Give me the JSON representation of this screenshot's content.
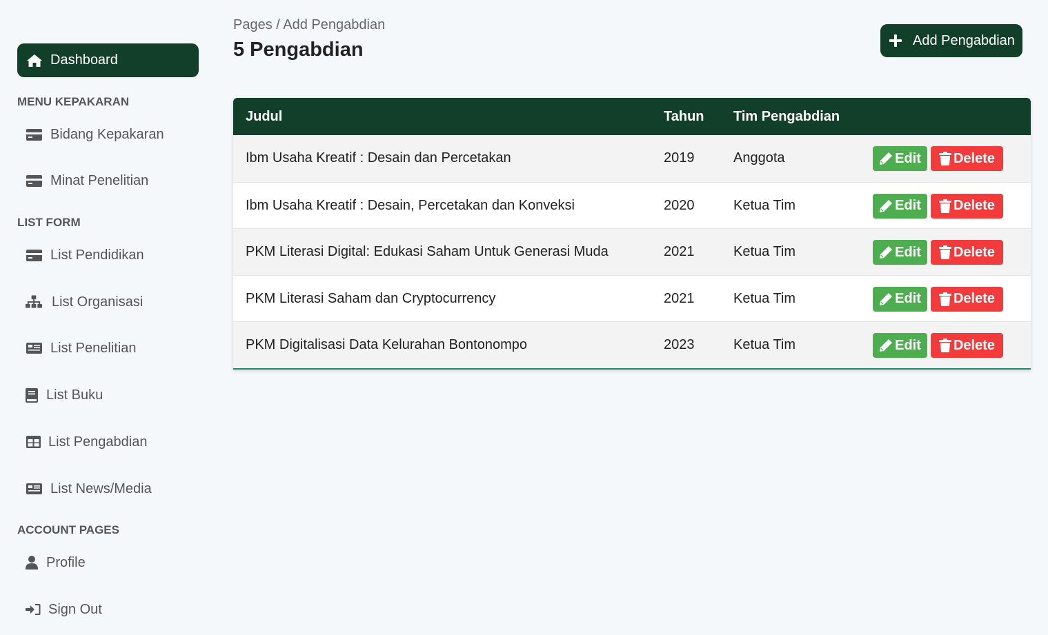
{
  "sidebar": {
    "dashboard_label": "Dashboard",
    "sections": {
      "menu_kepakaran": "MENU KEPAKARAN",
      "list_form": "LIST FORM",
      "account_pages": "ACCOUNT PAGES"
    },
    "items": {
      "bidang_kepakaran": "Bidang Kepakaran",
      "minat_penelitian": "Minat Penelitian",
      "list_pendidikan": "List Pendidikan",
      "list_organisasi": "List Organisasi",
      "list_penelitian": "List Penelitian",
      "list_buku": "List Buku",
      "list_pengabdian": "List Pengabdian",
      "list_news_media": "List News/Media",
      "profile": "Profile",
      "sign_out": "Sign Out"
    }
  },
  "header": {
    "breadcrumb": "Pages / Add Pengabdian",
    "title": "5 Pengabdian",
    "add_button_label": "Add Pengabdian"
  },
  "table": {
    "columns": [
      "Judul",
      "Tahun",
      "Tim Pengabdian"
    ],
    "edit_label": "Edit",
    "delete_label": "Delete",
    "rows": [
      {
        "judul": "Ibm Usaha Kreatif : Desain dan Percetakan",
        "tahun": "2019",
        "tim": "Anggota"
      },
      {
        "judul": "Ibm Usaha Kreatif : Desain, Percetakan dan Konveksi",
        "tahun": "2020",
        "tim": "Ketua Tim"
      },
      {
        "judul": "PKM Literasi Digital: Edukasi Saham Untuk Generasi Muda",
        "tahun": "2021",
        "tim": "Ketua Tim"
      },
      {
        "judul": "PKM Literasi Saham dan Cryptocurrency",
        "tahun": "2021",
        "tim": "Ketua Tim"
      },
      {
        "judul": "PKM Digitalisasi Data Kelurahan Bontonompo",
        "tahun": "2023",
        "tim": "Ketua Tim"
      }
    ]
  },
  "colors": {
    "primary_dark_green": "#123f2a",
    "edit_green": "#4cae4f",
    "delete_red": "#f43b3b",
    "background": "#f5f8fb"
  },
  "icons": {
    "dashboard": "home-icon",
    "bidang_kepakaran": "credit-card-icon",
    "minat_penelitian": "credit-card-icon",
    "list_pendidikan": "credit-card-icon",
    "list_organisasi": "sitemap-icon",
    "list_penelitian": "newspaper-icon",
    "list_buku": "book-icon",
    "list_pengabdian": "table-icon",
    "list_news_media": "newspaper-icon",
    "profile": "user-icon",
    "sign_out": "sign-in-icon",
    "add": "plus-icon",
    "edit": "pencil-icon",
    "delete": "trash-icon"
  }
}
